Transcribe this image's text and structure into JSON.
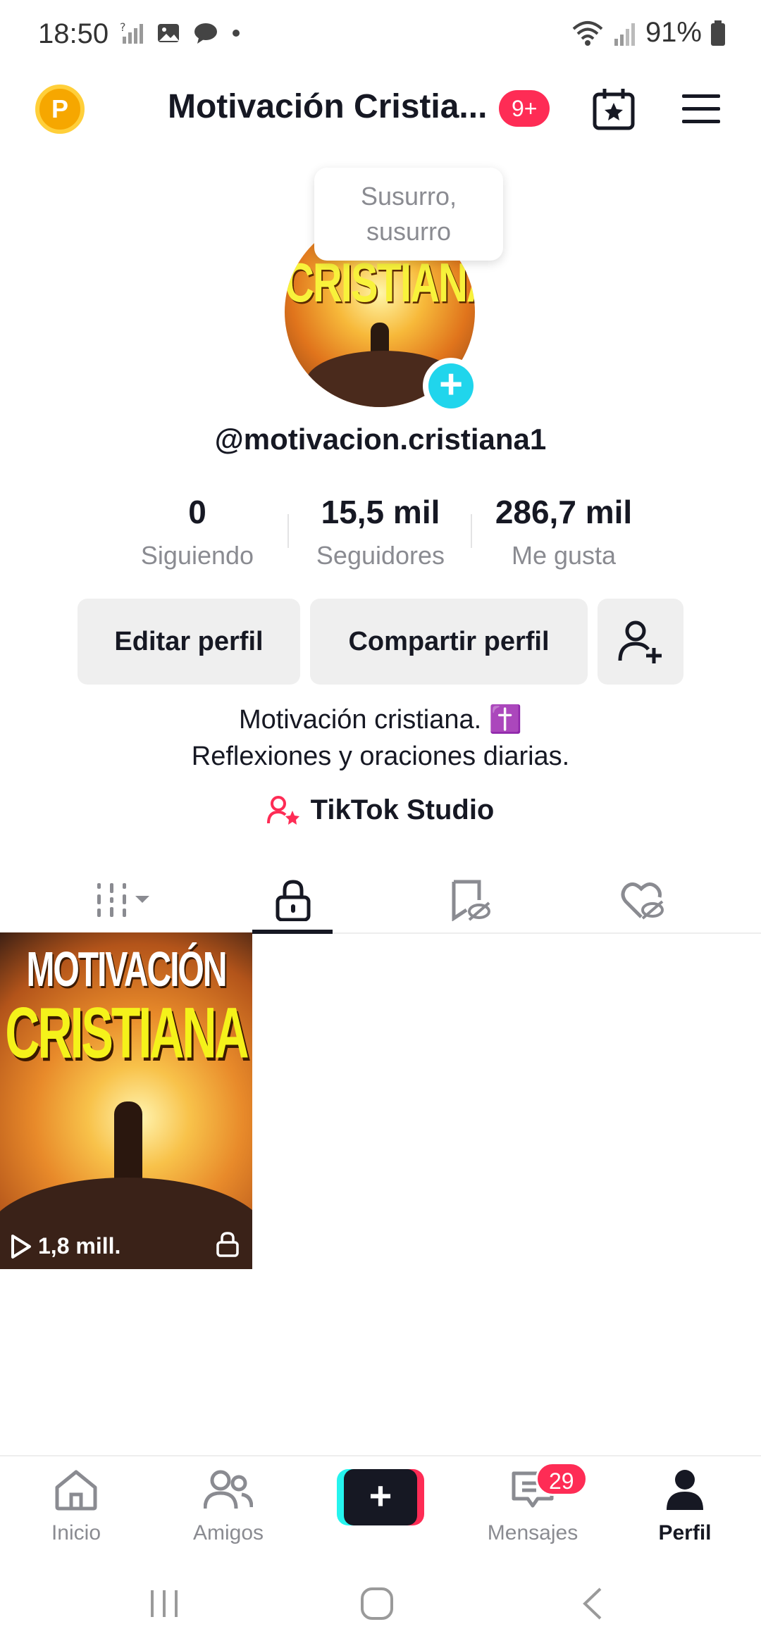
{
  "status_bar": {
    "time": "18:50",
    "battery": "91%"
  },
  "header": {
    "coin_letter": "P",
    "title": "Motivación Cristia...",
    "badge": "9+"
  },
  "profile": {
    "tooltip": "Susurro,\nsusurro",
    "avatar_text": "CRISTIANA",
    "username": "@motivacion.cristiana1"
  },
  "stats": [
    {
      "value": "0",
      "label": "Siguiendo"
    },
    {
      "value": "15,5 mil",
      "label": "Seguidores"
    },
    {
      "value": "286,7 mil",
      "label": "Me gusta"
    }
  ],
  "actions": {
    "edit": "Editar perfil",
    "share": "Compartir perfil"
  },
  "bio": {
    "line1": "Motivación cristiana. ✝️",
    "line2": "Reflexiones y oraciones diarias."
  },
  "studio_label": "TikTok Studio",
  "videos": [
    {
      "title_line1": "MOTIVACIÓN",
      "title_line2": "CRISTIANA",
      "views": "1,8 mill."
    }
  ],
  "bottom_nav": {
    "home": "Inicio",
    "friends": "Amigos",
    "messages": "Mensajes",
    "messages_badge": "29",
    "profile": "Perfil"
  },
  "colors": {
    "accent": "#fe2c55",
    "cyan": "#25f4ee",
    "text": "#161823",
    "muted": "#8a8b91"
  }
}
